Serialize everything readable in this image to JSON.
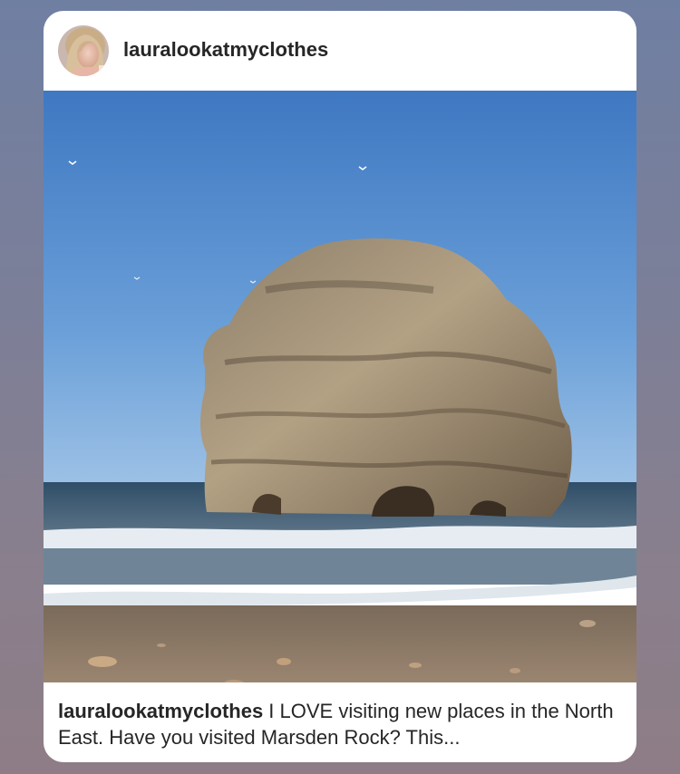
{
  "post": {
    "username": "lauralookatmyclothes",
    "caption_username": "lauralookatmyclothes",
    "caption_text": " I LOVE visiting new places in the North East. Have you visited Marsden Rock? This..."
  },
  "icons": {
    "avatar": "profile-photo",
    "photo": "sea-stack-beach-photo"
  }
}
